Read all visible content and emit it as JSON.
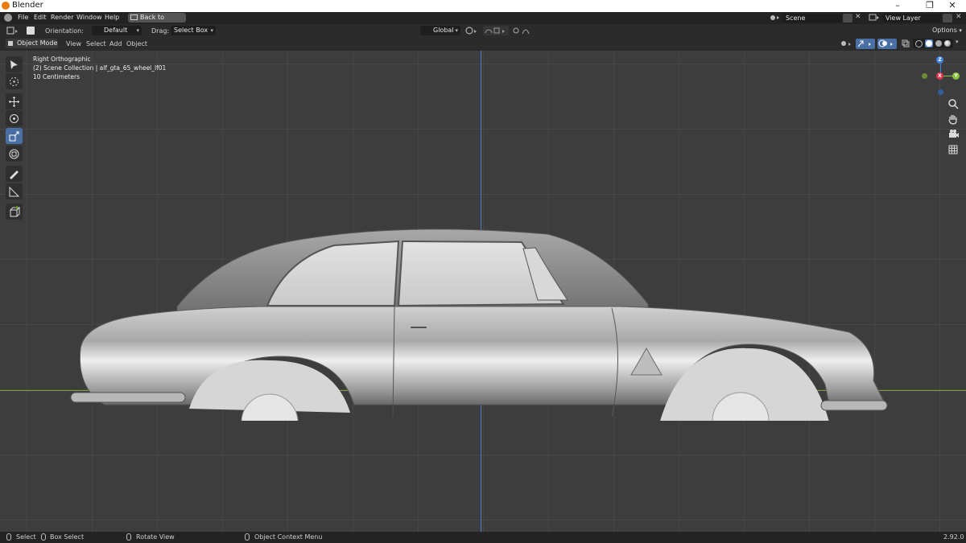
{
  "window": {
    "title": "Blender"
  },
  "menubar": {
    "items": [
      "File",
      "Edit",
      "Render",
      "Window",
      "Help"
    ],
    "back_button": "Back to Previous",
    "scene": "Scene",
    "view_layer": "View Layer"
  },
  "tool_header": {
    "orientation_label": "Orientation:",
    "orientation_value": "Default",
    "drag_label": "Drag:",
    "drag_value": "Select Box",
    "transform_orientation": "Global",
    "options": "Options"
  },
  "viewport_header": {
    "mode": "Object Mode",
    "menus": [
      "View",
      "Select",
      "Add",
      "Object"
    ]
  },
  "viewport_overlay": {
    "view_name": "Right Orthographic",
    "collection": "(2) Scene Collection | alf_gta_65_wheel_lf01",
    "scale": "10 Centimeters"
  },
  "gizmo": {
    "z": "Z",
    "x": "X",
    "y": "Y"
  },
  "toolbar_icons": [
    "select-box-icon",
    "cursor-icon",
    "move-icon",
    "rotate-icon",
    "scale-icon",
    "transform-icon",
    "annotate-icon",
    "measure-icon",
    "add-cube-icon"
  ],
  "status_bar": {
    "select": "Select",
    "box_select": "Box Select",
    "rotate_view": "Rotate View",
    "context_menu": "Object Context Menu",
    "version": "2.92.0"
  },
  "colors": {
    "accent": "#4a6fa5",
    "axis_x": "#e2344c",
    "axis_y": "#8ac43e",
    "axis_z": "#3c82e0",
    "viewport_bg": "#3d3d3d"
  }
}
